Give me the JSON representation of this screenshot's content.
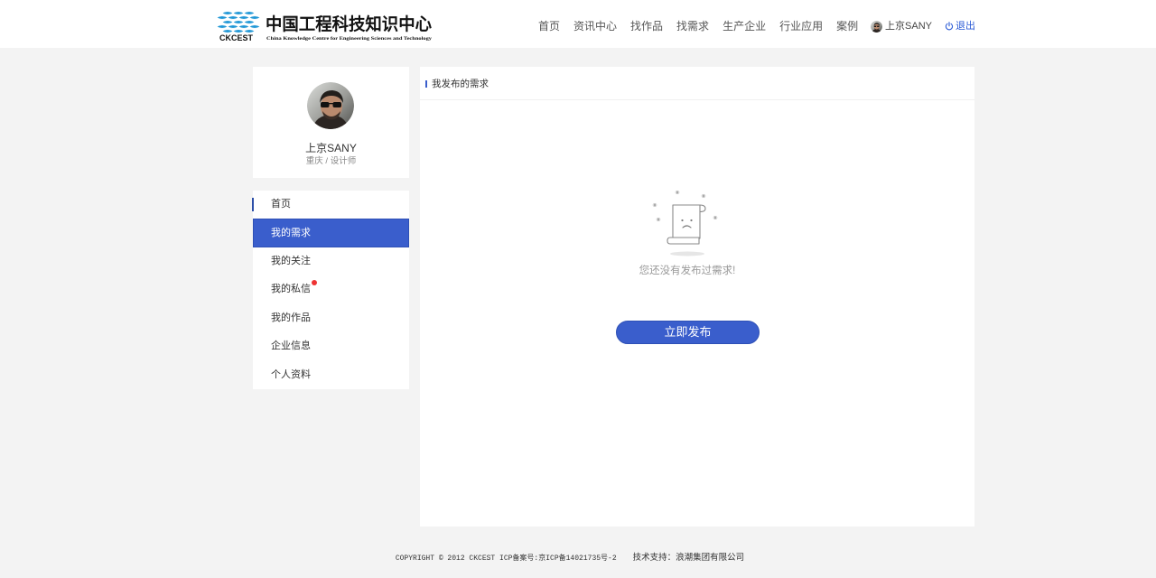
{
  "header": {
    "logo": {
      "icon": "ckcest-net-logo-icon",
      "abbr": "CKCEST",
      "title_cn": "中国工程科技知识中心",
      "title_en": "China Knowledge Centre for Engineering Sciences and Technology"
    },
    "nav": {
      "items": [
        {
          "label": "首页"
        },
        {
          "label": "资讯中心"
        },
        {
          "label": "找作品"
        },
        {
          "label": "找需求"
        },
        {
          "label": "生产企业"
        },
        {
          "label": "行业应用"
        },
        {
          "label": "案例"
        }
      ]
    },
    "user": {
      "avatar_icon": "user-avatar-photo",
      "name": "上京SANY",
      "logout_icon": "power-icon",
      "logout_label": "退出"
    }
  },
  "profile": {
    "avatar_icon": "user-avatar-photo",
    "name": "上京SANY",
    "meta": "重庆 / 设计师"
  },
  "menu": {
    "items": [
      {
        "label": "首页",
        "marker": true
      },
      {
        "label": "我的需求",
        "active": true
      },
      {
        "label": "我的关注"
      },
      {
        "label": "我的私信",
        "unread": true
      },
      {
        "label": "我的作品"
      },
      {
        "label": "企业信息"
      },
      {
        "label": "个人资料"
      }
    ]
  },
  "main": {
    "section_title": "我发布的需求",
    "empty_icon": "empty-document-sad-face-icon",
    "empty_message": "您还没有发布过需求!",
    "publish_button_label": "立即发布"
  },
  "footer": {
    "copyright": "COPYRIGHT © 2012 CKCEST ICP备案号:京ICP备14021735号-2",
    "support": "技术支持：浪潮集团有限公司"
  },
  "colors": {
    "primary": "#3a5ecc",
    "primary_border": "#2e50b6",
    "marker": "#2d4fa8",
    "link": "#2b5bd6",
    "background": "#f3f3f3",
    "text": "#333333",
    "muted": "#999999",
    "unread_dot": "#ee3333",
    "logo": "#1e96d6"
  }
}
